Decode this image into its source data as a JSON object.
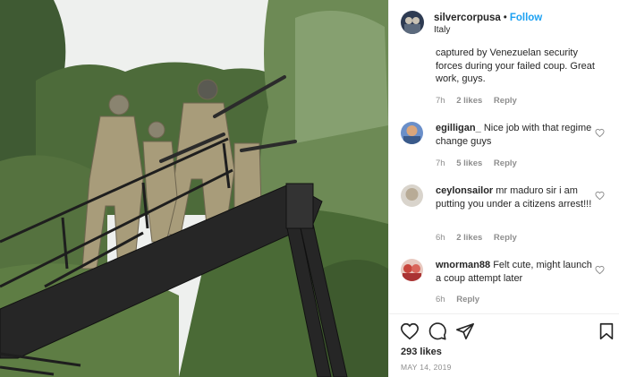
{
  "post": {
    "username": "silvercorpusa",
    "separator": "•",
    "follow_label": "Follow",
    "location": "Italy",
    "photo_alt": "Soldiers in camouflage with rifles standing on a raised ladder platform of a vehicle, trees in background"
  },
  "comments": [
    {
      "username": "",
      "text": "captured by Venezuelan security forces during your failed coup. Great work, guys.",
      "time": "7h",
      "likes": "2 likes",
      "reply": "Reply"
    },
    {
      "username": "egilligan_",
      "text": "Nice job with that regime change guys",
      "time": "7h",
      "likes": "5 likes",
      "reply": "Reply"
    },
    {
      "username": "ceylonsailor",
      "text": "mr maduro sir i am putting you under a citizens arrest!!!",
      "time": "6h",
      "likes": "2 likes",
      "reply": "Reply"
    },
    {
      "username": "wnorman88",
      "text": "Felt cute, might launch a coup attempt later",
      "time": "6h",
      "likes": "",
      "reply": "Reply"
    }
  ],
  "actions": {
    "like_icon": "heart-icon",
    "comment_icon": "comment-icon",
    "share_icon": "share-icon",
    "save_icon": "bookmark-icon"
  },
  "stats": {
    "likes": "293 likes",
    "date": "MAY 14, 2019"
  },
  "colors": {
    "follow": "#1da1f2",
    "meta": "#8e8e8e",
    "text": "#262626"
  }
}
